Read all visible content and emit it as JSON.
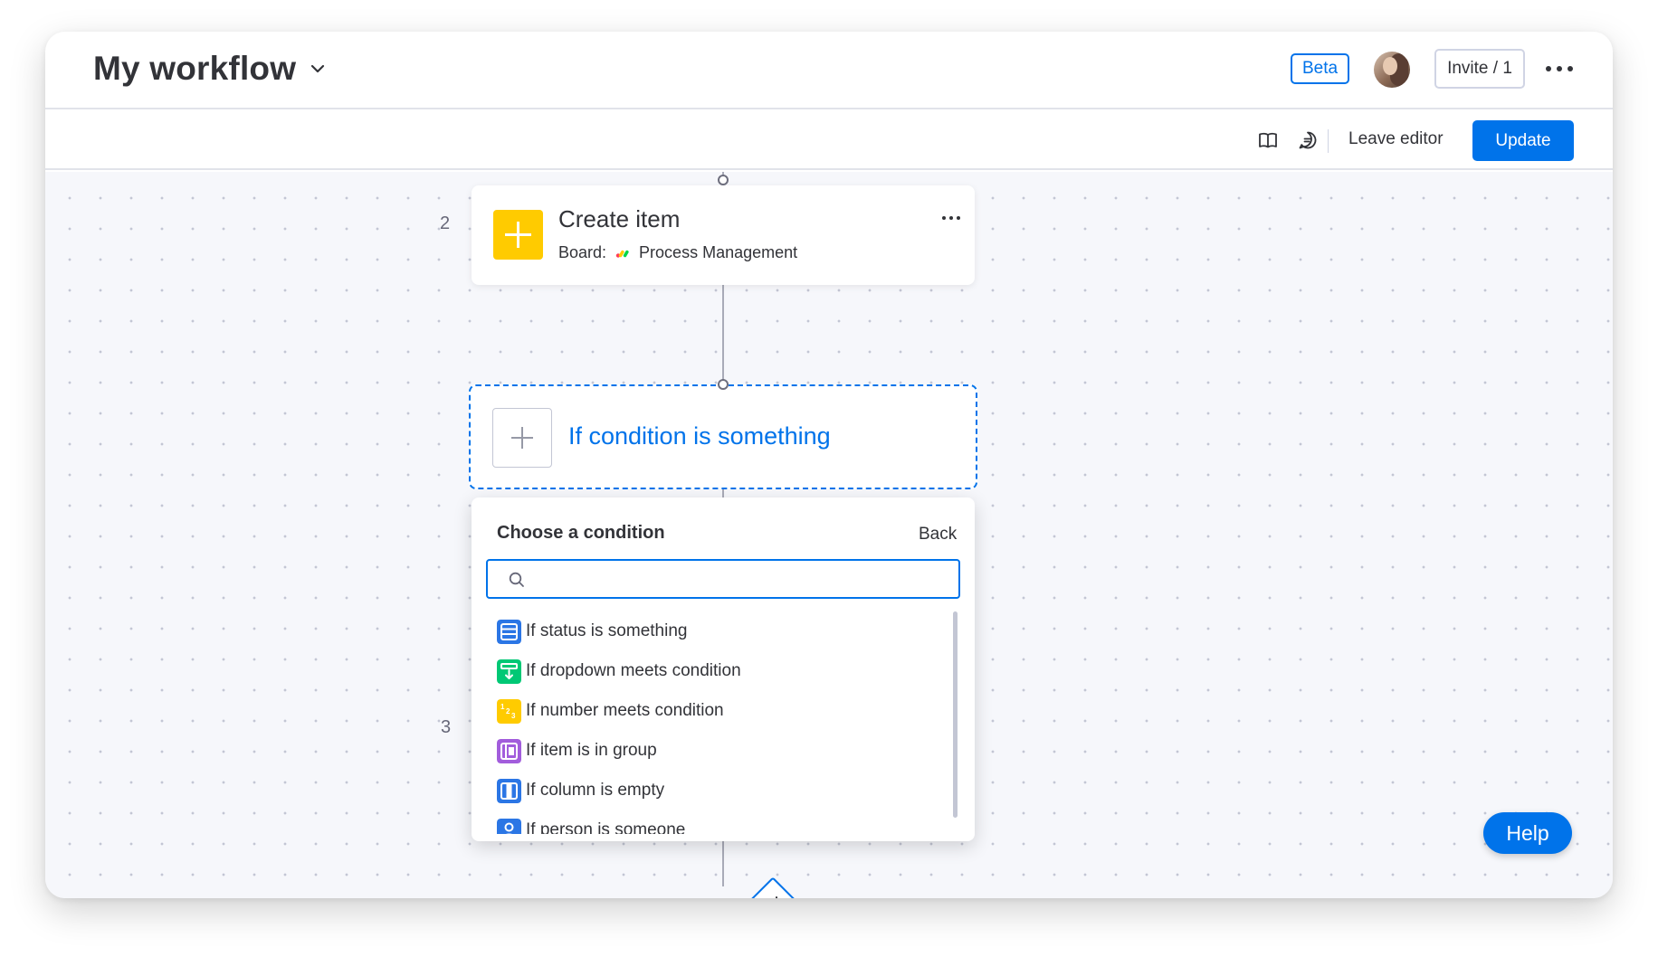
{
  "header": {
    "title": "My workflow",
    "beta_label": "Beta",
    "invite_label": "Invite / 1"
  },
  "toolbar": {
    "leave_label": "Leave editor",
    "update_label": "Update"
  },
  "steps": [
    {
      "number": "2"
    },
    {
      "number": "3"
    }
  ],
  "create_card": {
    "title": "Create item",
    "board_label": "Board:",
    "board_name": "Process Management"
  },
  "condition_card": {
    "label": "If condition is something"
  },
  "condition_dropdown": {
    "title": "Choose a condition",
    "back_label": "Back",
    "search_value": "",
    "items": [
      {
        "label": "If status is something",
        "icon": "status-column-icon",
        "color": "#2b76e5"
      },
      {
        "label": "If dropdown meets condition",
        "icon": "dropdown-column-icon",
        "color": "#00c875"
      },
      {
        "label": "If number meets condition",
        "icon": "numbers-column-icon",
        "color": "#ffcb00"
      },
      {
        "label": "If item is in group",
        "icon": "group-icon",
        "color": "#a25ddc"
      },
      {
        "label": "If column is empty",
        "icon": "column-icon",
        "color": "#2b76e5"
      },
      {
        "label": "If person is someone",
        "icon": "person-column-icon",
        "color": "#2b76e5"
      }
    ]
  },
  "help_label": "Help",
  "colors": {
    "primary": "#0073ea",
    "create_icon": "#ffcb00",
    "canvas": "#f6f7fb"
  }
}
